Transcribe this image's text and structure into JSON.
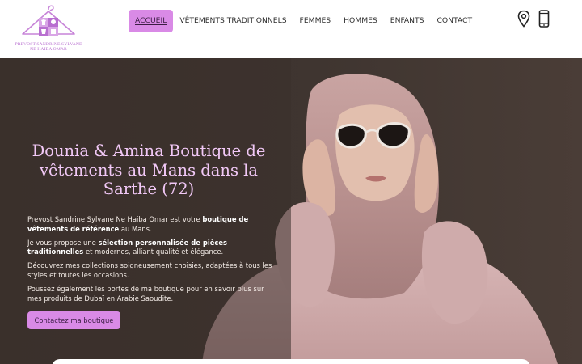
{
  "header": {
    "logo": {
      "line1": "PREVOST SANDRINE SYLVANE",
      "line2": "NE HAIBA OMAR"
    },
    "nav": [
      {
        "label": "ACCUEIL",
        "active": true
      },
      {
        "label": "VÊTEMENTS TRADITIONNELS",
        "active": false
      },
      {
        "label": "FEMMES",
        "active": false
      },
      {
        "label": "HOMMES",
        "active": false
      },
      {
        "label": "ENFANTS",
        "active": false
      },
      {
        "label": "CONTACT",
        "active": false
      }
    ],
    "icons": [
      "map-pin-icon",
      "mobile-phone-icon"
    ]
  },
  "hero": {
    "title": "Dounia & Amina Boutique de vêtements au Mans dans la Sarthe (72)",
    "paragraphs": [
      {
        "before": "Prevost Sandrine Sylvane Ne Haiba Omar est votre ",
        "bold": "boutique de vêtements de référence",
        "after": " au Mans."
      },
      {
        "before": "Je vous propose une ",
        "bold": "sélection personnalisée de pièces traditionnelles",
        "after": " et modernes, alliant qualité et élégance."
      },
      {
        "before": "",
        "bold": "",
        "after": "Découvrez mes collections soigneusement choisies, adaptées à tous les styles et toutes les occasions."
      },
      {
        "before": "",
        "bold": "",
        "after": "Poussez également les portes de ma boutique pour en savoir plus sur mes produits de Dubaï en Arabie Saoudite."
      }
    ],
    "cta_label": "Contactez ma boutique"
  },
  "colors": {
    "accent": "#d98ae6",
    "hero_bg": "#3d332e",
    "title_pink": "#f1c8f6",
    "logo_purple": "#b86fd0"
  }
}
